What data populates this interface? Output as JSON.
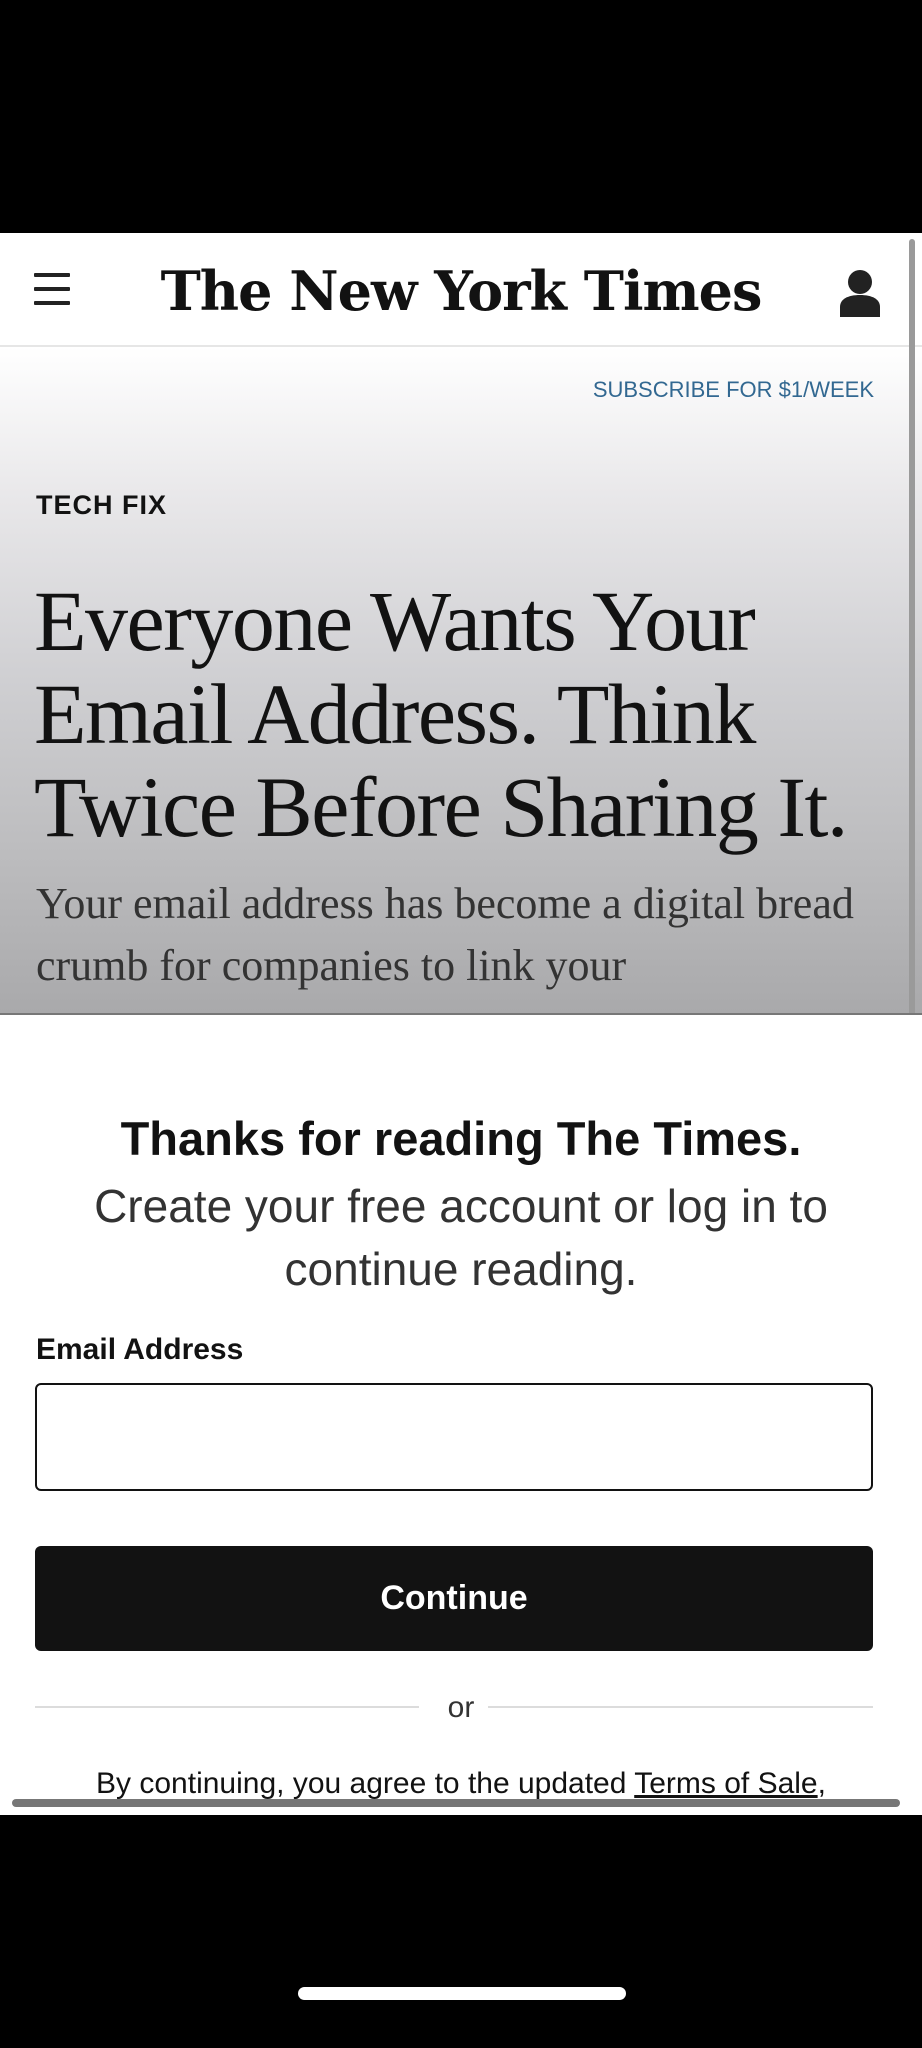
{
  "header": {
    "logo": "The New York Times"
  },
  "hero": {
    "subscribe_link": "SUBSCRIBE FOR $1/WEEK",
    "kicker": "TECH FIX",
    "headline": "Everyone Wants Your Email Address. Think Twice Before Sharing It.",
    "summary": "Your email address has become a digital bread crumb for companies to link your"
  },
  "paywall": {
    "title": "Thanks for reading The Times.",
    "subtitle": "Create your free account or log in to continue reading.",
    "email_label": "Email Address",
    "email_value": "",
    "continue_label": "Continue",
    "or_label": "or",
    "terms_prefix": "By continuing, you agree to the updated ",
    "terms_link": "Terms of Sale",
    "terms_suffix": ","
  },
  "icons": {
    "menu": "menu-icon",
    "account": "person-icon"
  }
}
